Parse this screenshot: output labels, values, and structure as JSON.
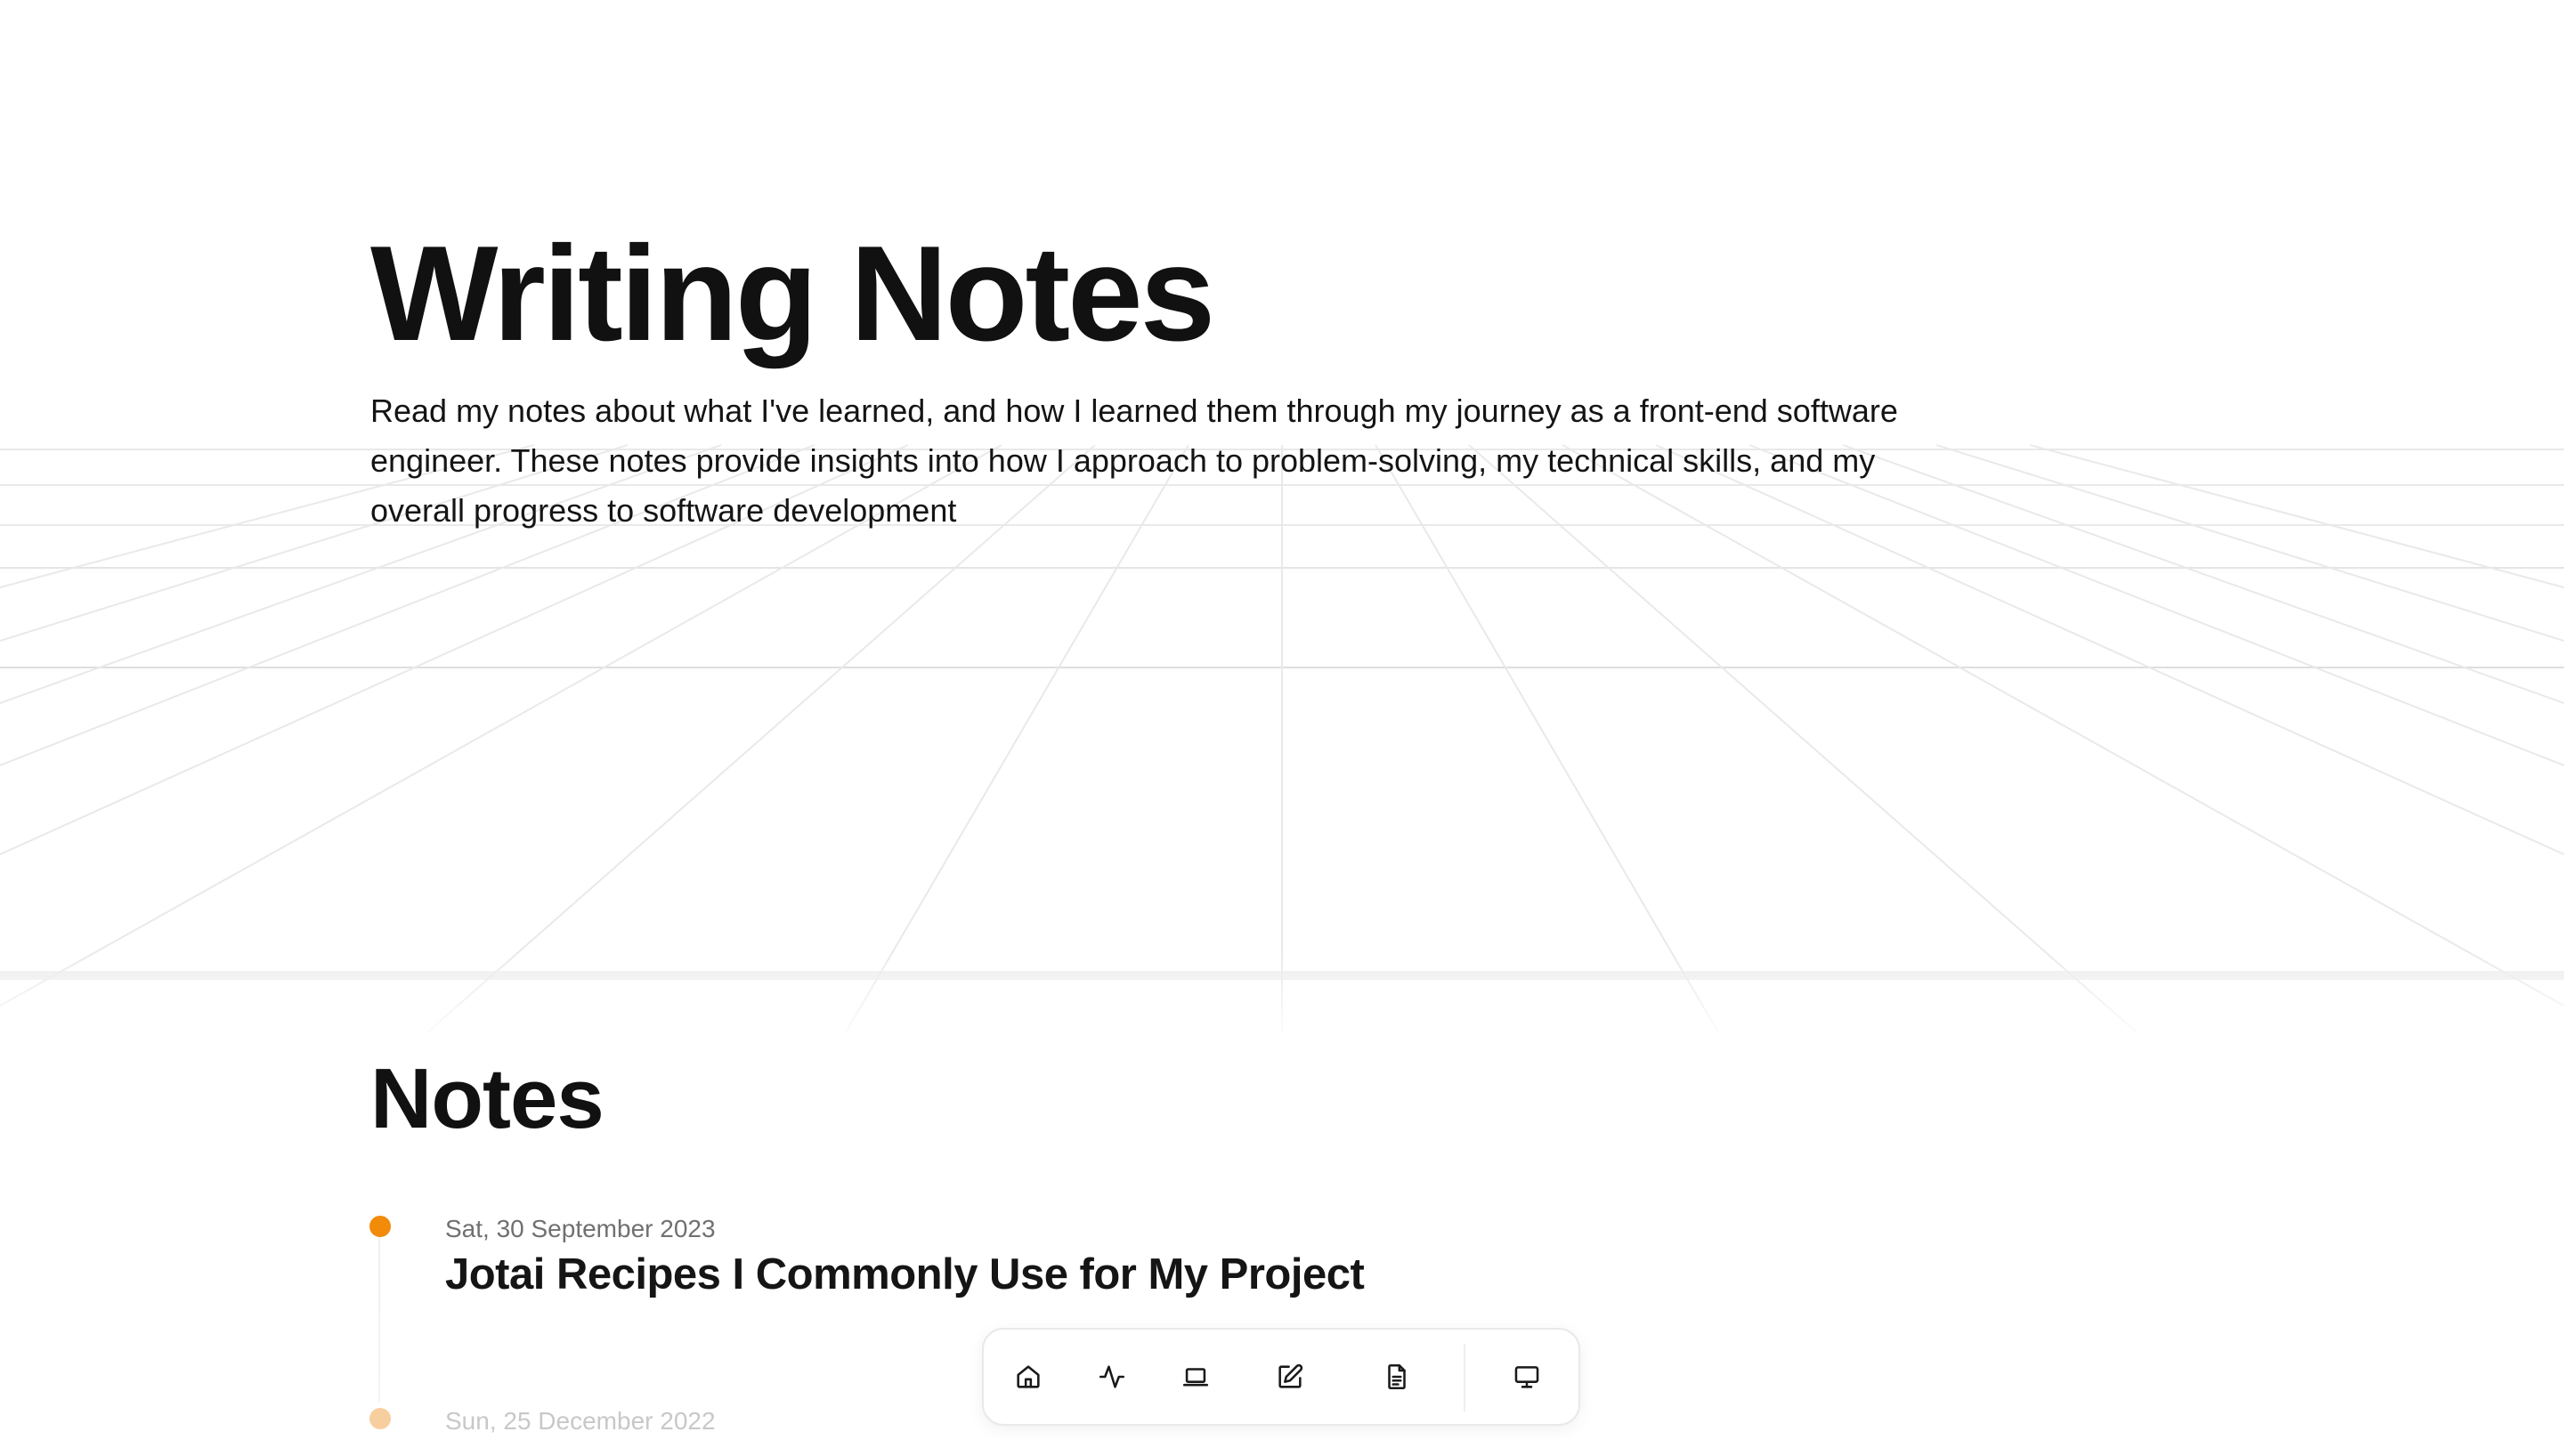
{
  "hero": {
    "title": "Writing Notes",
    "description": "Read my notes about what I've learned, and how I learned them through my journey as a front-end software engineer. These notes provide insights into how I approach to problem-solving, my technical skills, and my overall progress to software development"
  },
  "notes": {
    "heading": "Notes",
    "items": [
      {
        "date": "Sat, 30 September 2023",
        "title": "Jotai Recipes I Commonly Use for My Project",
        "dot_color": "#f28a0a"
      },
      {
        "date": "Sun, 25 December 2022",
        "title": "",
        "dot_color": "#f7cf9f"
      }
    ]
  },
  "dock": {
    "items": [
      {
        "icon": "home-icon"
      },
      {
        "icon": "activity-icon"
      },
      {
        "icon": "laptop-icon"
      },
      {
        "icon": "edit-icon"
      },
      {
        "icon": "document-icon"
      },
      {
        "icon": "monitor-icon"
      }
    ]
  },
  "colors": {
    "accent": "#f28a0a",
    "accent_faded": "#f7cf9f",
    "text": "#111111",
    "muted": "#707070"
  }
}
